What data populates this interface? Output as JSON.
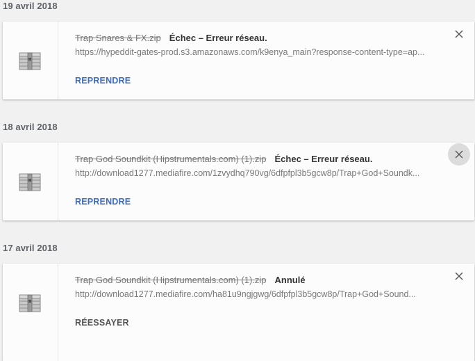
{
  "colors": {
    "page_bg": "#f1f1f1",
    "card_bg": "#fcfcfc",
    "action_blue": "#3b6cc6",
    "action_gray": "#555555"
  },
  "groups": [
    {
      "date": "19 avril 2018",
      "item": {
        "icon": "zip-archive-icon",
        "file_name": "Trap Snares & FX.zip",
        "status": "Échec – Erreur réseau.",
        "url": "https://hypeddit-gates-prod.s3.amazonaws.com/k9enya_main?response-content-type=ap...",
        "action": "REPRENDRE"
      }
    },
    {
      "date": "18 avril 2018",
      "item": {
        "icon": "zip-archive-icon",
        "file_name": "Trap God Soundkit (Hipstrumentals.com) (1).zip",
        "status": "Échec – Erreur réseau.",
        "url": "http://download1277.mediafire.com/1zvydhq790vg/6dfpfpl3b5gcw8p/Trap+God+Soundk...",
        "action": "REPRENDRE",
        "close_hovered": true
      }
    },
    {
      "date": "17 avril 2018",
      "item": {
        "icon": "zip-archive-icon",
        "file_name": "Trap God Soundkit (Hipstrumentals.com) (1).zip",
        "status": "Annulé",
        "url": "http://download1277.mediafire.com/ha81u9ngjgwg/6dfpfpl3b5gcw8p/Trap+God+Sound...",
        "action": "RÉESSAYER"
      }
    }
  ]
}
